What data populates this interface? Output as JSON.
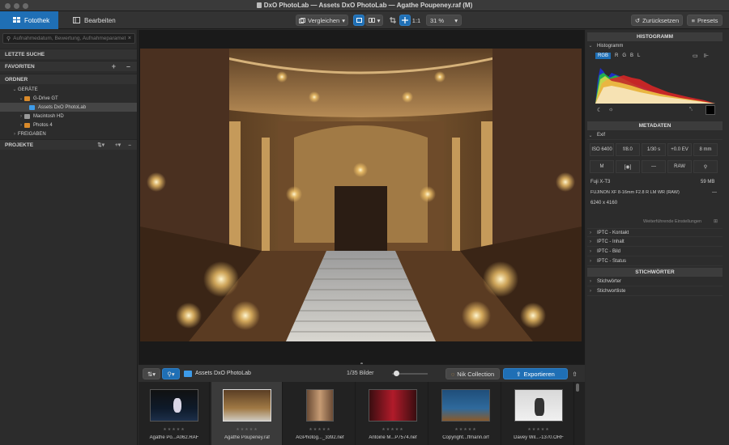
{
  "window": {
    "title": "DxO PhotoLab — Assets DxO PhotoLab — Agathe Poupeney.raf (M)"
  },
  "tabs": [
    {
      "label": "Fotothek"
    },
    {
      "label": "Bearbeiten"
    }
  ],
  "toolbar": {
    "compare_label": "Vergleichen",
    "ratio_label": "1:1",
    "zoom": "31 %",
    "reset_label": "Zurücksetzen",
    "presets_label": "Presets"
  },
  "left": {
    "search_placeholder": "Aufnahmedatum, Bewertung, Aufnahmeparameter",
    "sections": {
      "recent": "LETZTE SUCHE",
      "favorites": "FAVORITEN",
      "folders": "ORDNER",
      "projects": "PROJEKTE"
    },
    "tree": {
      "devices": "GERÄTE",
      "gdrive": "G-Drive GT",
      "assets": "Assets DxO PhotoLab",
      "macintosh": "Macintosh HD",
      "photos": "Photos 4",
      "shares": "FREIGABEN"
    }
  },
  "right": {
    "histogram": {
      "header": "HISTOGRAMM",
      "label": "Histogramm",
      "channels": [
        "RGB",
        "R",
        "G",
        "B",
        "L"
      ]
    },
    "metadata": {
      "header": "METADATEN",
      "exif_label": "Exif",
      "exif": [
        "ISO 6400",
        "f/8.0",
        "1/30 s",
        "+0.0 EV",
        "8 mm"
      ],
      "modes": [
        "M",
        "[◉]",
        "—",
        "RAW",
        "⚲"
      ],
      "camera": "Fuji X-T3",
      "filesize": "59 MB",
      "lens": "FUJINON XF 8-16mm F2.8 R LM WR (RAW)",
      "lens_extra": "—",
      "dimensions": "6240 x 4160",
      "more": "Weiterführende Einstellungen",
      "iptc": [
        "IPTC - Kontakt",
        "IPTC - Inhalt",
        "IPTC - Bild",
        "IPTC - Status"
      ]
    },
    "keywords": {
      "header": "STICHWÖRTER",
      "items": [
        "Stichwörter",
        "Stichwortliste"
      ]
    }
  },
  "filmstrip": {
    "folder": "Assets DxO PhotoLab",
    "count": "1/35 Bilder",
    "nik_label": "Nik Collection",
    "export_label": "Exportieren",
    "items": [
      {
        "name": "Agathe Po...A062.RAF"
      },
      {
        "name": "Agathe Poupeney.raf"
      },
      {
        "name": "AGPhotog..._3392.nef"
      },
      {
        "name": "Antoine M...P7574.nef"
      },
      {
        "name": "Copyright...ffmann.orf"
      },
      {
        "name": "Davey Wil...-1370.ORF"
      }
    ]
  },
  "colors": {
    "accent": "#1f6fb5",
    "export": "#1f6fb5",
    "panel": "#2c2c2c",
    "viewer": "#1a1a1a"
  },
  "icons": [
    "compare-icon",
    "grid-icon",
    "crop-icon",
    "move-icon",
    "reset-icon",
    "presets-icon",
    "folder-icon",
    "export-icon",
    "share-icon"
  ]
}
